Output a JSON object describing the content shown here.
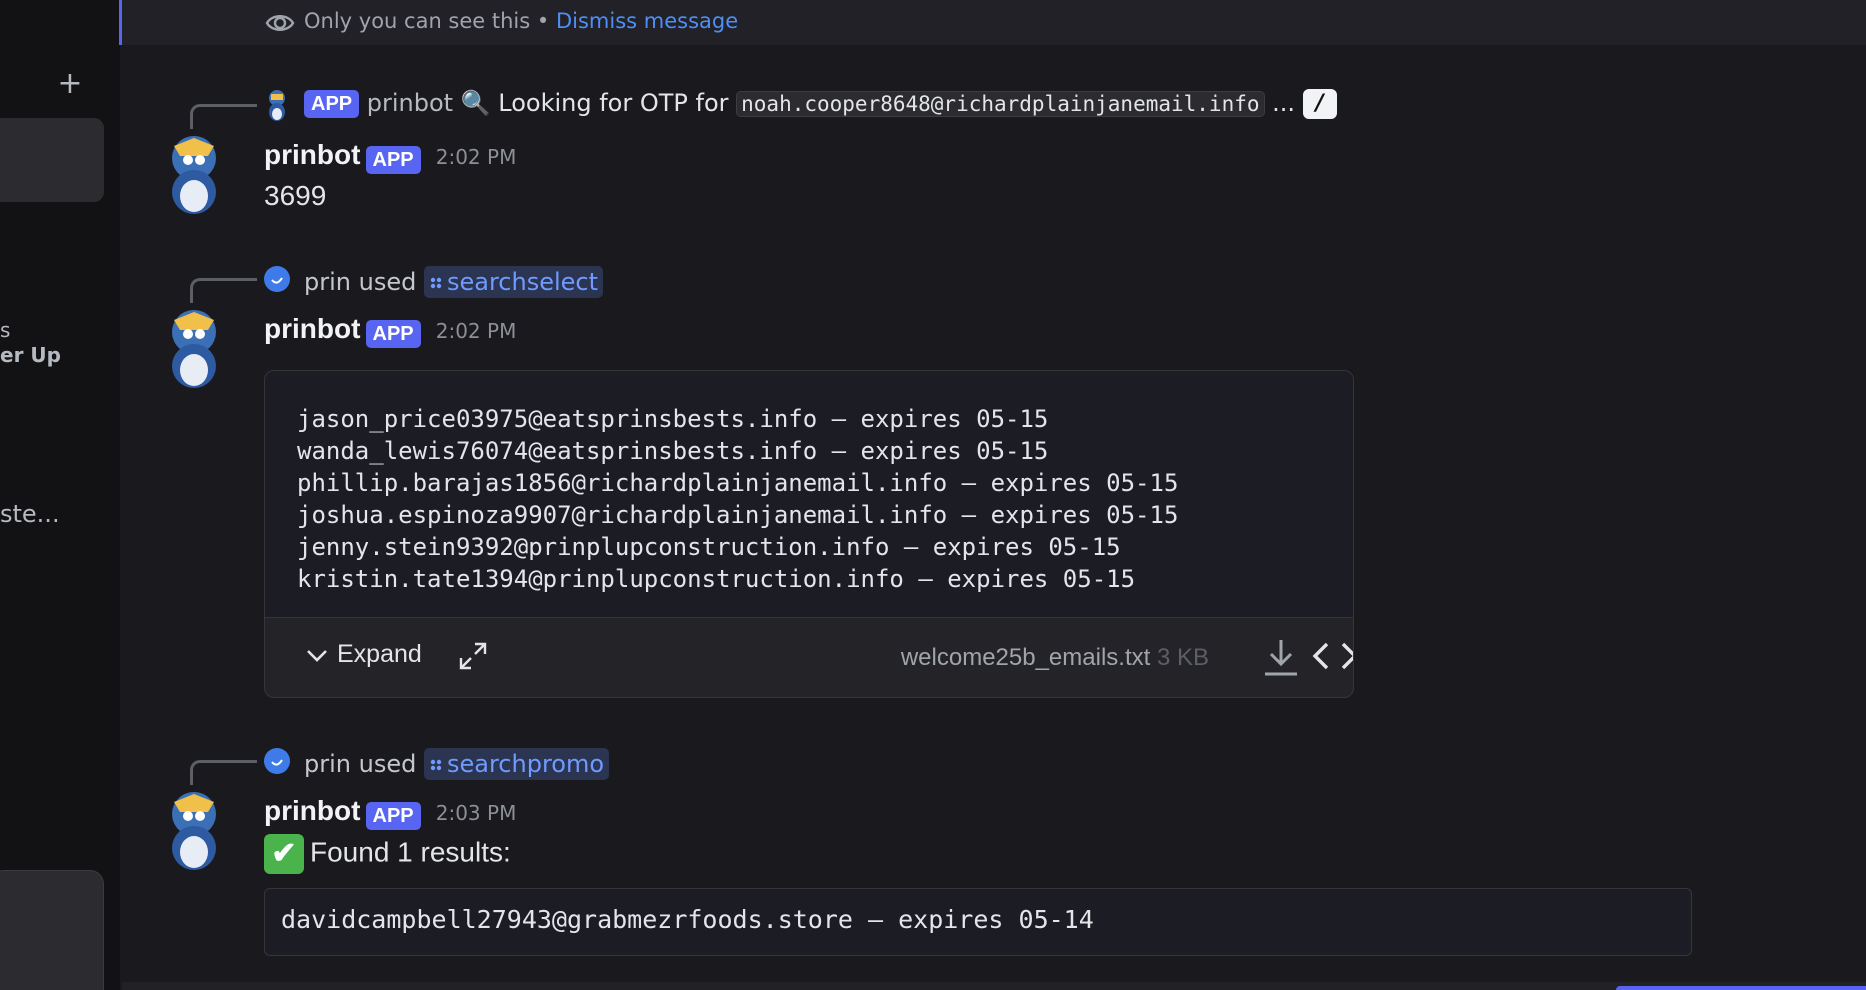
{
  "sidebar": {
    "add_glyph": "+",
    "fragments": [
      "s",
      "er Up",
      "ste..."
    ]
  },
  "ephemeral": {
    "notice": "Only you can see this",
    "separator": " • ",
    "dismiss": "Dismiss message"
  },
  "messages": [
    {
      "reply": {
        "badge": "APP",
        "author": "prinbot",
        "emoji": "🔍",
        "text": "Looking for OTP for",
        "code": "noah.cooper8648@richardplainjanemail.info",
        "ellipsis": "..."
      },
      "author": "prinbot",
      "badge": "APP",
      "time": "2:02 PM",
      "text": "3699"
    },
    {
      "reply": {
        "user": "prin",
        "action": "used",
        "command": "searchselect"
      },
      "author": "prinbot",
      "badge": "APP",
      "time": "2:02 PM",
      "attachment": {
        "lines": [
          "jason_price03975@eatsprinsbests.info — expires 05-15",
          "wanda_lewis76074@eatsprinsbests.info — expires 05-15",
          "phillip.barajas1856@richardplainjanemail.info — expires 05-15",
          "joshua.espinoza9907@richardplainjanemail.info — expires 05-15",
          "jenny.stein9392@prinplupconstruction.info — expires 05-15",
          "kristin.tate1394@prinplupconstruction.info — expires 05-15"
        ],
        "expand_label": "Expand",
        "file_name": "welcome25b_emails.txt",
        "file_size": "3 KB"
      }
    },
    {
      "reply": {
        "user": "prin",
        "action": "used",
        "command": "searchpromo"
      },
      "author": "prinbot",
      "badge": "APP",
      "time": "2:03 PM",
      "emoji": "✔",
      "text": "Found 1 results:",
      "code": "davidcampbell27943@grabmezrfoods.store — expires 05-14"
    }
  ],
  "colors": {
    "background": "#1a1a1e",
    "accent": "#5865f2",
    "link": "#4e8ff6"
  },
  "icons": [
    "eye-icon",
    "plus-icon",
    "bot-avatar",
    "user-avatar",
    "command-icon",
    "slash-command-icon",
    "chevron-down-icon",
    "fullscreen-icon",
    "download-icon",
    "code-icon",
    "check-emoji-icon",
    "magnifier-emoji-icon"
  ]
}
